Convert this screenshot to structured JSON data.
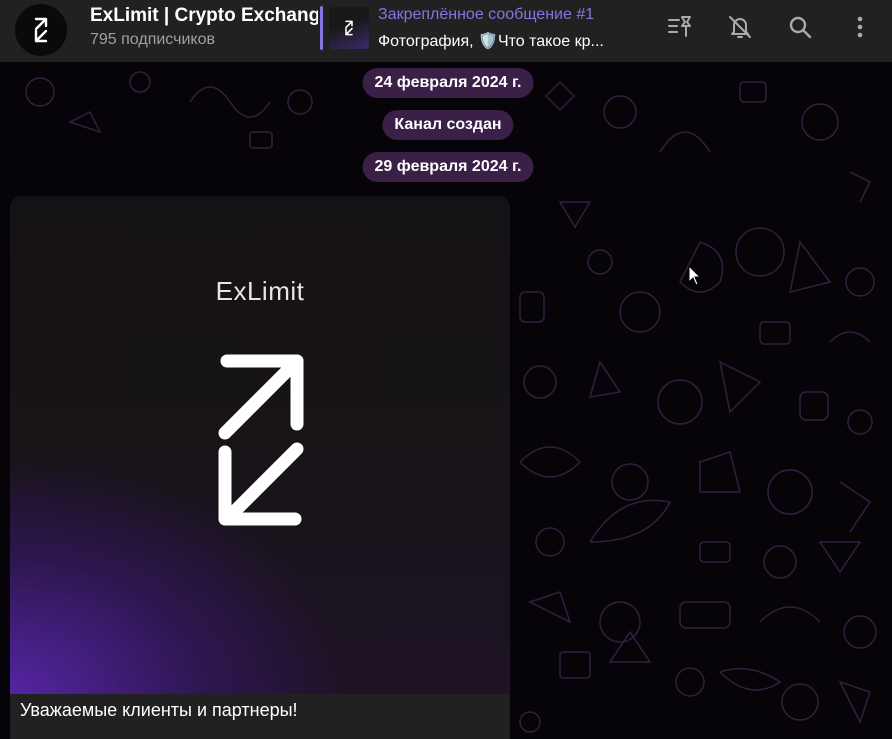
{
  "header": {
    "channel_title": "ExLimit | Crypto Exchange",
    "subscribers": "795 подписчиков",
    "pinned": {
      "title": "Закреплённое сообщение #1",
      "text": "Фотография, 🛡️Что такое кр..."
    },
    "icons": [
      "pinned-list-icon",
      "mute-bell-icon",
      "search-icon",
      "more-vertical-icon"
    ]
  },
  "chat": {
    "service_messages": [
      "24 февраля 2024 г.",
      "Канал создан",
      "29 февраля 2024 г."
    ],
    "message": {
      "image_brand_text": "ExLimit",
      "caption": "Уважаемые клиенты и партнеры!"
    }
  },
  "colors": {
    "header_bg": "#212121",
    "accent": "#8774e1",
    "pill_bg": "#3a1f47",
    "bubble_bg": "#212121"
  }
}
